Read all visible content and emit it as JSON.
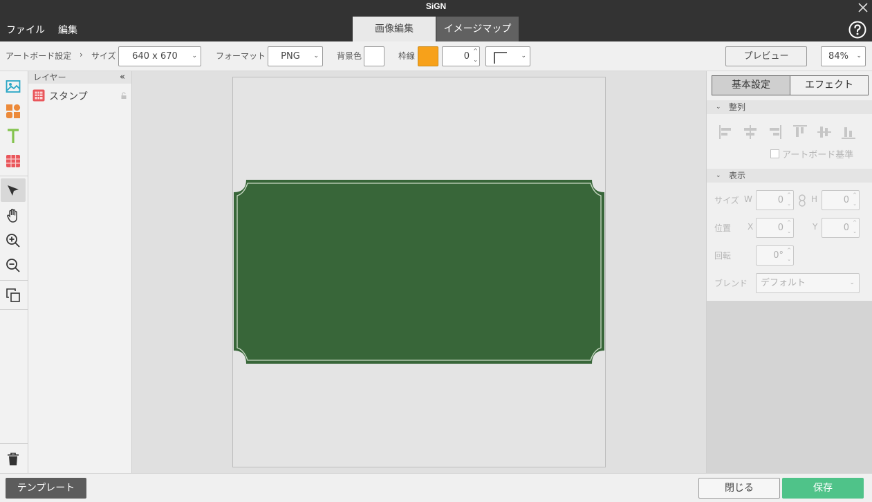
{
  "window": {
    "title": "SiGN"
  },
  "menu": {
    "file": "ファイル",
    "edit": "編集"
  },
  "tabs": {
    "image_edit": "画像編集",
    "image_map": "イメージマップ"
  },
  "toolbar": {
    "breadcrumb_root": "アートボード設定",
    "breadcrumb_sep": "›",
    "size_label": "サイズ",
    "size_value": "640 x 670",
    "format_label": "フォーマット",
    "format_value": "PNG",
    "bg_label": "背景色",
    "bg_color": "#ffffff",
    "border_label": "枠線",
    "border_color": "#f7a11a",
    "border_width": "0",
    "preview_button": "プレビュー",
    "zoom_value": "84%"
  },
  "tools": [
    "image-tool-icon",
    "shapes-tool-icon",
    "text-tool-icon",
    "table-tool-icon",
    "select-tool-icon",
    "hand-tool-icon",
    "zoom-in-icon",
    "zoom-out-icon",
    "duplicate-icon",
    "trash-icon"
  ],
  "layers": {
    "header": "レイヤー",
    "collapse": "«",
    "items": [
      {
        "name": "スタンプ"
      }
    ]
  },
  "canvas": {
    "shape_color": "#386639",
    "shape_border": "#c9d9c4"
  },
  "right_panel": {
    "tab_basic": "基本設定",
    "tab_effect": "エフェクト",
    "align_section": "整列",
    "artboard_basis": "アートボード基準",
    "display_section": "表示",
    "size_label": "サイズ",
    "w_label": "W",
    "w_value": "0",
    "h_label": "H",
    "h_value": "0",
    "position_label": "位置",
    "x_label": "X",
    "x_value": "0",
    "y_label": "Y",
    "y_value": "0",
    "rotation_label": "回転",
    "rotation_value": "0°",
    "blend_label": "ブレンド",
    "blend_value": "デフォルト"
  },
  "bottom": {
    "template_button": "テンプレート",
    "close_button": "閉じる",
    "save_button": "保存"
  },
  "colors": {
    "accent_green": "#4fc389",
    "title_bar": "#333333"
  }
}
